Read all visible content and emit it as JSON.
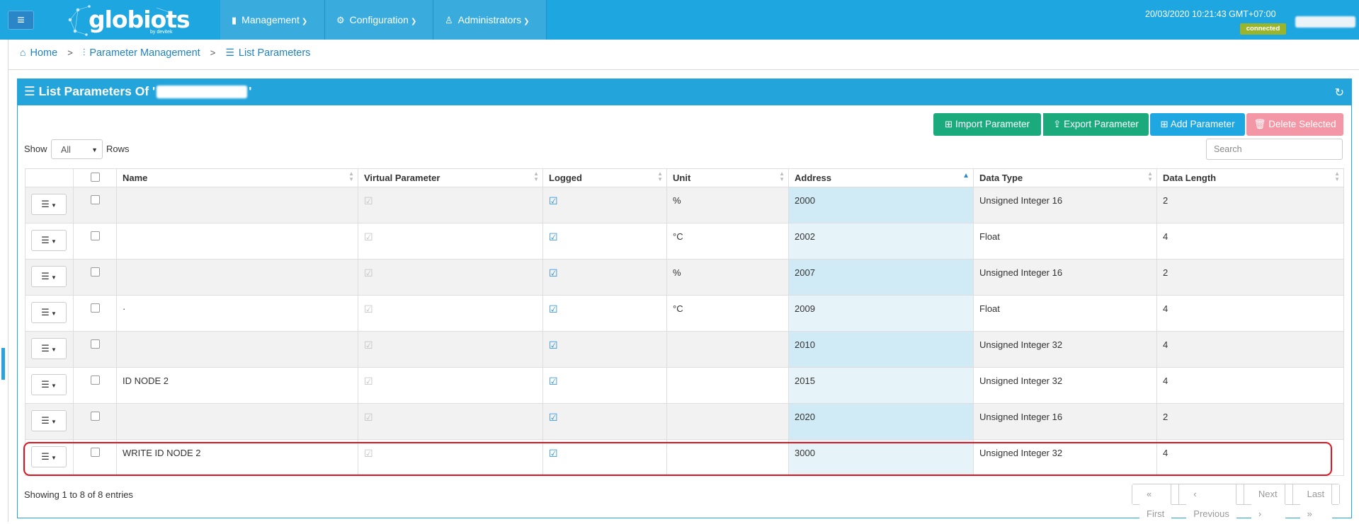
{
  "topbar": {
    "logo_text": "globiots",
    "logo_sub": "by devitek",
    "nav": [
      {
        "label": "Management",
        "icon": "battery-icon"
      },
      {
        "label": "Configuration",
        "icon": "gears-icon"
      },
      {
        "label": "Administrators",
        "icon": "sitemap-icon"
      }
    ],
    "clock": "20/03/2020 10:21:43 GMT+07:00",
    "status": "connected"
  },
  "breadcrumb": {
    "home": "Home",
    "parameter_management": "Parameter Management",
    "list_parameters": "List Parameters"
  },
  "panel": {
    "title_prefix": "List Parameters Of '",
    "title_suffix": "'",
    "buttons": {
      "import": "Import Parameter",
      "export": "Export Parameter",
      "add": "Add Parameter",
      "delete": "Delete Selected"
    },
    "show_label": "Show",
    "show_value": "All",
    "rows_label": "Rows",
    "search_placeholder": "Search"
  },
  "table": {
    "columns": [
      "",
      "",
      "Name",
      "Virtual Parameter",
      "Logged",
      "Unit",
      "Address",
      "Data Type",
      "Data Length"
    ],
    "sorted_column": "Address",
    "rows": [
      {
        "name": "",
        "unit": "%",
        "address": "2000",
        "data_type": "Unsigned Integer 16",
        "data_length": "2"
      },
      {
        "name": "",
        "unit": "°C",
        "address": "2002",
        "data_type": "Float",
        "data_length": "4"
      },
      {
        "name": "",
        "unit": "%",
        "address": "2007",
        "data_type": "Unsigned Integer 16",
        "data_length": "2"
      },
      {
        "name": "·",
        "unit": "°C",
        "address": "2009",
        "data_type": "Float",
        "data_length": "4"
      },
      {
        "name": "",
        "unit": "",
        "address": "2010",
        "data_type": "Unsigned Integer 32",
        "data_length": "4"
      },
      {
        "name": "ID NODE 2",
        "unit": "",
        "address": "2015",
        "data_type": "Unsigned Integer 32",
        "data_length": "4"
      },
      {
        "name": "",
        "unit": "",
        "address": "2020",
        "data_type": "Unsigned Integer 16",
        "data_length": "2"
      },
      {
        "name": "WRITE ID NODE 2",
        "unit": "",
        "address": "3000",
        "data_type": "Unsigned Integer 32",
        "data_length": "4"
      }
    ],
    "highlighted_row": 8
  },
  "footer": {
    "info": "Showing 1 to 8 of 8 entries",
    "pager": {
      "first": "First",
      "previous": "Previous",
      "next": "Next",
      "last": "Last"
    }
  },
  "colors": {
    "topbar": "#1ea6e0",
    "panel_header": "#23a5dc",
    "green_button": "#1aaa7c",
    "blue_button": "#1ea7e1",
    "pink_button": "#f397a6",
    "highlight": "#e0131f",
    "status_badge": "#9ab52b"
  }
}
